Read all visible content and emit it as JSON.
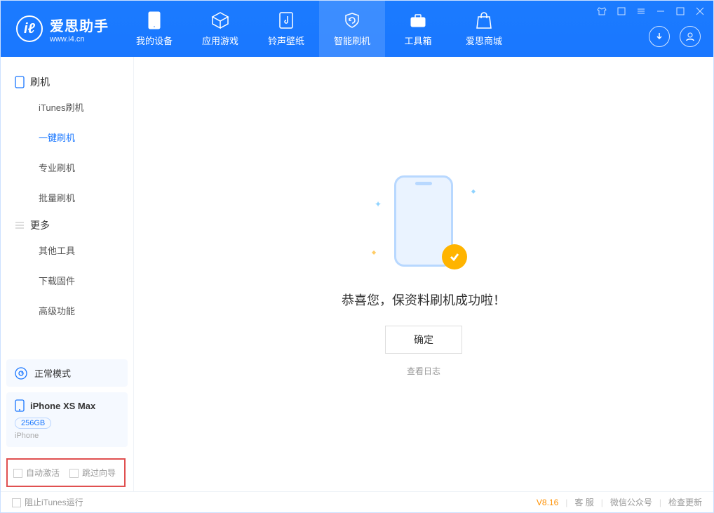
{
  "app": {
    "title": "爱思助手",
    "subtitle": "www.i4.cn"
  },
  "nav": {
    "device": "我的设备",
    "apps": "应用游戏",
    "ring": "铃声壁纸",
    "flash": "智能刷机",
    "tools": "工具箱",
    "store": "爱思商城"
  },
  "sidebar": {
    "group_flash": "刷机",
    "items_flash": {
      "itunes": "iTunes刷机",
      "onekey": "一键刷机",
      "pro": "专业刷机",
      "batch": "批量刷机"
    },
    "group_more": "更多",
    "items_more": {
      "other": "其他工具",
      "firmware": "下载固件",
      "advanced": "高级功能"
    },
    "status": "正常模式",
    "device": {
      "name": "iPhone XS Max",
      "capacity": "256GB",
      "type": "iPhone"
    },
    "opt_auto": "自动激活",
    "opt_skip": "跳过向导"
  },
  "main": {
    "message": "恭喜您，保资料刷机成功啦！",
    "ok": "确定",
    "view_log": "查看日志"
  },
  "footer": {
    "block_itunes": "阻止iTunes运行",
    "version": "V8.16",
    "cs": "客 服",
    "wechat": "微信公众号",
    "update": "检查更新"
  }
}
